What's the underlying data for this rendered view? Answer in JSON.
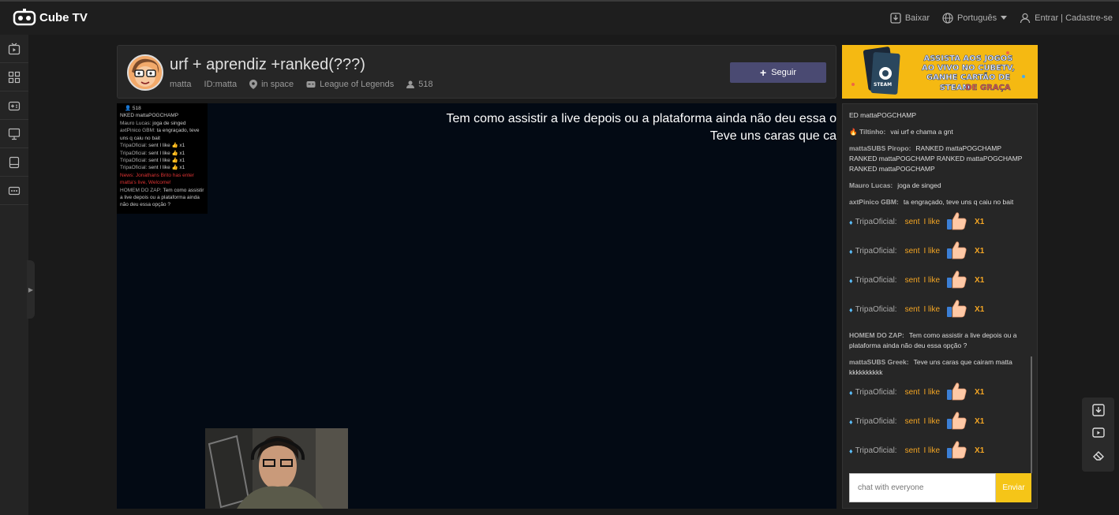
{
  "brand": {
    "name": "Cube TV"
  },
  "topbar": {
    "download_label": "Baixar",
    "language_label": "Português",
    "auth_label": "Entrar | Cadastre-se"
  },
  "sidebar": {
    "items": [
      "live-icon",
      "grid-icon",
      "gamepad-icon",
      "monitor-icon",
      "tablet-icon",
      "more-icon"
    ]
  },
  "stream": {
    "title": "urf + aprendiz +ranked(???)",
    "streamer": "matta",
    "id_label": "ID:matta",
    "location": "in space",
    "game": "League of Legends",
    "viewers": "518",
    "follow_label": "Seguir"
  },
  "video": {
    "overlay_line1": "Tem como assistir a live depois ou a plataforma ainda não deu essa o",
    "overlay_line2": "Teve uns caras que ca",
    "mini_viewers": "518",
    "mini_lines": [
      {
        "name": "",
        "text": "NKED mattaPOGCHAMP"
      },
      {
        "name": "Mauro Lucas:",
        "text": "joga de singed"
      },
      {
        "name": "axtPinico GBM:",
        "text": "ta engraçado, teve uns q caiu no bait"
      },
      {
        "name": "TripaOficial:",
        "text": "sent I like 👍 x1"
      },
      {
        "name": "TripaOficial:",
        "text": "sent I like 👍 x1"
      },
      {
        "name": "TripaOficial:",
        "text": "sent I like 👍 x1"
      },
      {
        "name": "TripaOficial:",
        "text": "sent I like 👍 x1"
      },
      {
        "name": "",
        "text": "News: Jonathans Brito has enter matta's live, Welcome!"
      },
      {
        "name": "HOMEM DO ZAP:",
        "text": "Tem como assistir a live depois ou a plataforma ainda não deu essa opção ?"
      }
    ]
  },
  "ad": {
    "line1": "ASSISTA AOS JOGOS",
    "line2": "AO VIVO NO CUBETV,",
    "line3": "GANHE CARTÃO DE",
    "line4": "STEAM",
    "line5": "DE GRAÇA",
    "card_label": "STEAM"
  },
  "chat": {
    "messages": [
      {
        "type": "text",
        "user": "",
        "text": "ED mattaPOGCHAMP"
      },
      {
        "type": "text",
        "user": "🔥 Tiltinho:",
        "text": "vai urf e chama a gnt"
      },
      {
        "type": "text",
        "user": "mattaSUBS Piropo:",
        "text": "RANKED mattaPOGCHAMP RANKED mattaPOGCHAMP RANKED mattaPOGCHAMP RANKED mattaPOGCHAMP"
      },
      {
        "type": "text",
        "user": "Mauro Lucas:",
        "text": "joga de singed"
      },
      {
        "type": "text",
        "user": "axtPinico GBM:",
        "text": "ta engraçado, teve uns q caiu no bait"
      },
      {
        "type": "gift",
        "user": "TripaOficial:",
        "sent": "sent",
        "gift": "I like",
        "count": "X1"
      },
      {
        "type": "gift",
        "user": "TripaOficial:",
        "sent": "sent",
        "gift": "I like",
        "count": "X1"
      },
      {
        "type": "gift",
        "user": "TripaOficial:",
        "sent": "sent",
        "gift": "I like",
        "count": "X1"
      },
      {
        "type": "gift",
        "user": "TripaOficial:",
        "sent": "sent",
        "gift": "I like",
        "count": "X1"
      },
      {
        "type": "text",
        "user": "HOMEM DO ZAP:",
        "text": "Tem como assistir a live depois ou a plataforma ainda não deu essa opção ?"
      },
      {
        "type": "text",
        "user": "mattaSUBS Greek:",
        "text": "Teve uns caras que cairam matta kkkkkkkkkk"
      },
      {
        "type": "gift",
        "user": "TripaOficial:",
        "sent": "sent",
        "gift": "I like",
        "count": "X1"
      },
      {
        "type": "gift",
        "user": "TripaOficial:",
        "sent": "sent",
        "gift": "I like",
        "count": "X1"
      },
      {
        "type": "gift",
        "user": "TripaOficial:",
        "sent": "sent",
        "gift": "I like",
        "count": "X1"
      }
    ],
    "input_placeholder": "chat with everyone",
    "send_label": "Enviar"
  },
  "float_tools": [
    "download-icon",
    "video-icon",
    "eraser-icon"
  ],
  "colors": {
    "accent": "#f5c518",
    "gift": "#f5a623",
    "follow": "#4a4a72"
  }
}
